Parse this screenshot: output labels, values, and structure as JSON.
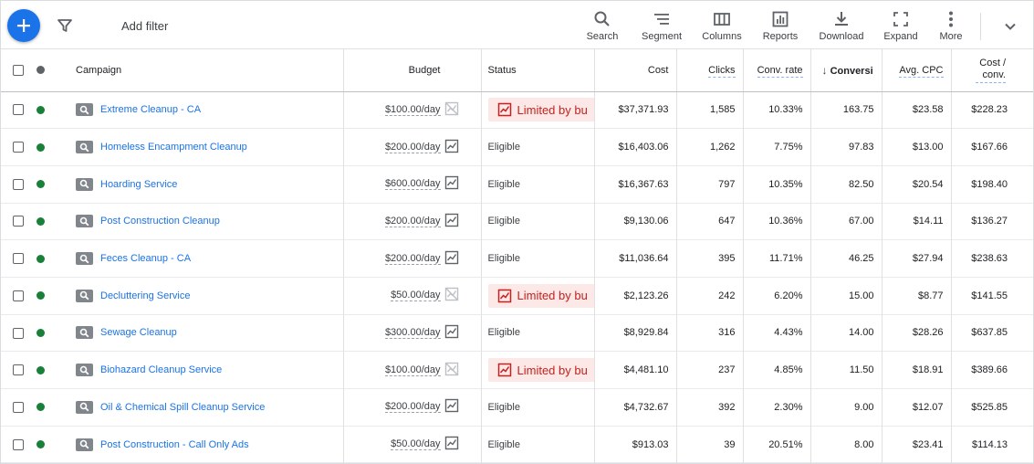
{
  "toolbar": {
    "add_filter": "Add filter",
    "tools": [
      {
        "name": "search",
        "label": "Search"
      },
      {
        "name": "segment",
        "label": "Segment"
      },
      {
        "name": "columns",
        "label": "Columns"
      },
      {
        "name": "reports",
        "label": "Reports"
      },
      {
        "name": "download",
        "label": "Download"
      },
      {
        "name": "expand",
        "label": "Expand"
      },
      {
        "name": "more",
        "label": "More"
      }
    ],
    "fab_color": "#1a73e8"
  },
  "table": {
    "headers": {
      "campaign": "Campaign",
      "budget": "Budget",
      "status": "Status",
      "cost": "Cost",
      "clicks": "Clicks",
      "conv_rate": "Conv. rate",
      "conversions": "Conversi",
      "avg_cpc": "Avg. CPC",
      "cost_conv_1": "Cost /",
      "cost_conv_2": "conv."
    },
    "rows": [
      {
        "campaign": "Extreme Cleanup - CA",
        "budget": "$100.00/day",
        "status": "Limited by bu",
        "limited": true,
        "cost": "$37,371.93",
        "clicks": "1,585",
        "conv_rate": "10.33%",
        "conversions": "163.75",
        "avg_cpc": "$23.58",
        "cost_conv": "$228.23"
      },
      {
        "campaign": "Homeless Encampment Cleanup",
        "budget": "$200.00/day",
        "status": "Eligible",
        "limited": false,
        "cost": "$16,403.06",
        "clicks": "1,262",
        "conv_rate": "7.75%",
        "conversions": "97.83",
        "avg_cpc": "$13.00",
        "cost_conv": "$167.66"
      },
      {
        "campaign": "Hoarding Service",
        "budget": "$600.00/day",
        "status": "Eligible",
        "limited": false,
        "cost": "$16,367.63",
        "clicks": "797",
        "conv_rate": "10.35%",
        "conversions": "82.50",
        "avg_cpc": "$20.54",
        "cost_conv": "$198.40"
      },
      {
        "campaign": "Post Construction Cleanup",
        "budget": "$200.00/day",
        "status": "Eligible",
        "limited": false,
        "cost": "$9,130.06",
        "clicks": "647",
        "conv_rate": "10.36%",
        "conversions": "67.00",
        "avg_cpc": "$14.11",
        "cost_conv": "$136.27"
      },
      {
        "campaign": "Feces Cleanup - CA",
        "budget": "$200.00/day",
        "status": "Eligible",
        "limited": false,
        "cost": "$11,036.64",
        "clicks": "395",
        "conv_rate": "11.71%",
        "conversions": "46.25",
        "avg_cpc": "$27.94",
        "cost_conv": "$238.63"
      },
      {
        "campaign": "Decluttering Service",
        "budget": "$50.00/day",
        "status": "Limited by bu",
        "limited": true,
        "cost": "$2,123.26",
        "clicks": "242",
        "conv_rate": "6.20%",
        "conversions": "15.00",
        "avg_cpc": "$8.77",
        "cost_conv": "$141.55"
      },
      {
        "campaign": "Sewage Cleanup",
        "budget": "$300.00/day",
        "status": "Eligible",
        "limited": false,
        "cost": "$8,929.84",
        "clicks": "316",
        "conv_rate": "4.43%",
        "conversions": "14.00",
        "avg_cpc": "$28.26",
        "cost_conv": "$637.85"
      },
      {
        "campaign": "Biohazard Cleanup Service",
        "budget": "$100.00/day",
        "status": "Limited by bu",
        "limited": true,
        "cost": "$4,481.10",
        "clicks": "237",
        "conv_rate": "4.85%",
        "conversions": "11.50",
        "avg_cpc": "$18.91",
        "cost_conv": "$389.66"
      },
      {
        "campaign": "Oil & Chemical Spill Cleanup Service",
        "budget": "$200.00/day",
        "status": "Eligible",
        "limited": false,
        "cost": "$4,732.67",
        "clicks": "392",
        "conv_rate": "2.30%",
        "conversions": "9.00",
        "avg_cpc": "$12.07",
        "cost_conv": "$525.85"
      },
      {
        "campaign": "Post Construction - Call Only Ads",
        "budget": "$50.00/day",
        "status": "Eligible",
        "limited": false,
        "cost": "$913.03",
        "clicks": "39",
        "conv_rate": "20.51%",
        "conversions": "8.00",
        "avg_cpc": "$23.41",
        "cost_conv": "$114.13"
      }
    ]
  },
  "colors": {
    "link": "#1a73e8",
    "enabled_dot": "#188038",
    "limited_bg": "#fce8e6",
    "limited_text": "#c5221f"
  }
}
